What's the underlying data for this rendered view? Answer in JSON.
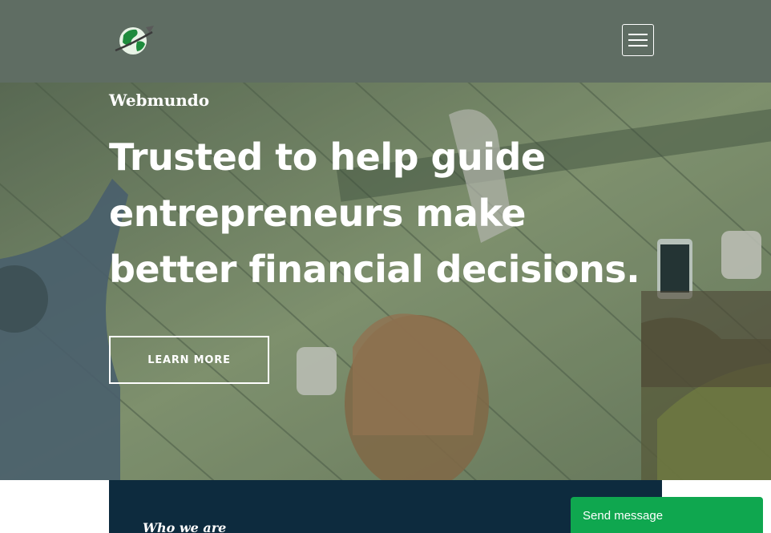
{
  "header": {
    "logo_icon": "globe-plane-logo",
    "menu_icon": "hamburger-menu-icon"
  },
  "hero": {
    "brand": "Webmundo",
    "headline_lines": [
      "Trusted to help guide",
      "entrepreneurs make",
      "better financial decisions."
    ],
    "cta_label": "LEARN MORE"
  },
  "about": {
    "label": "Who we are"
  },
  "chat": {
    "label": "Send message"
  },
  "colors": {
    "header_bg": "#5f6d63",
    "panel_bg": "#0d2b3e",
    "chat_bg": "#0fa74f"
  }
}
